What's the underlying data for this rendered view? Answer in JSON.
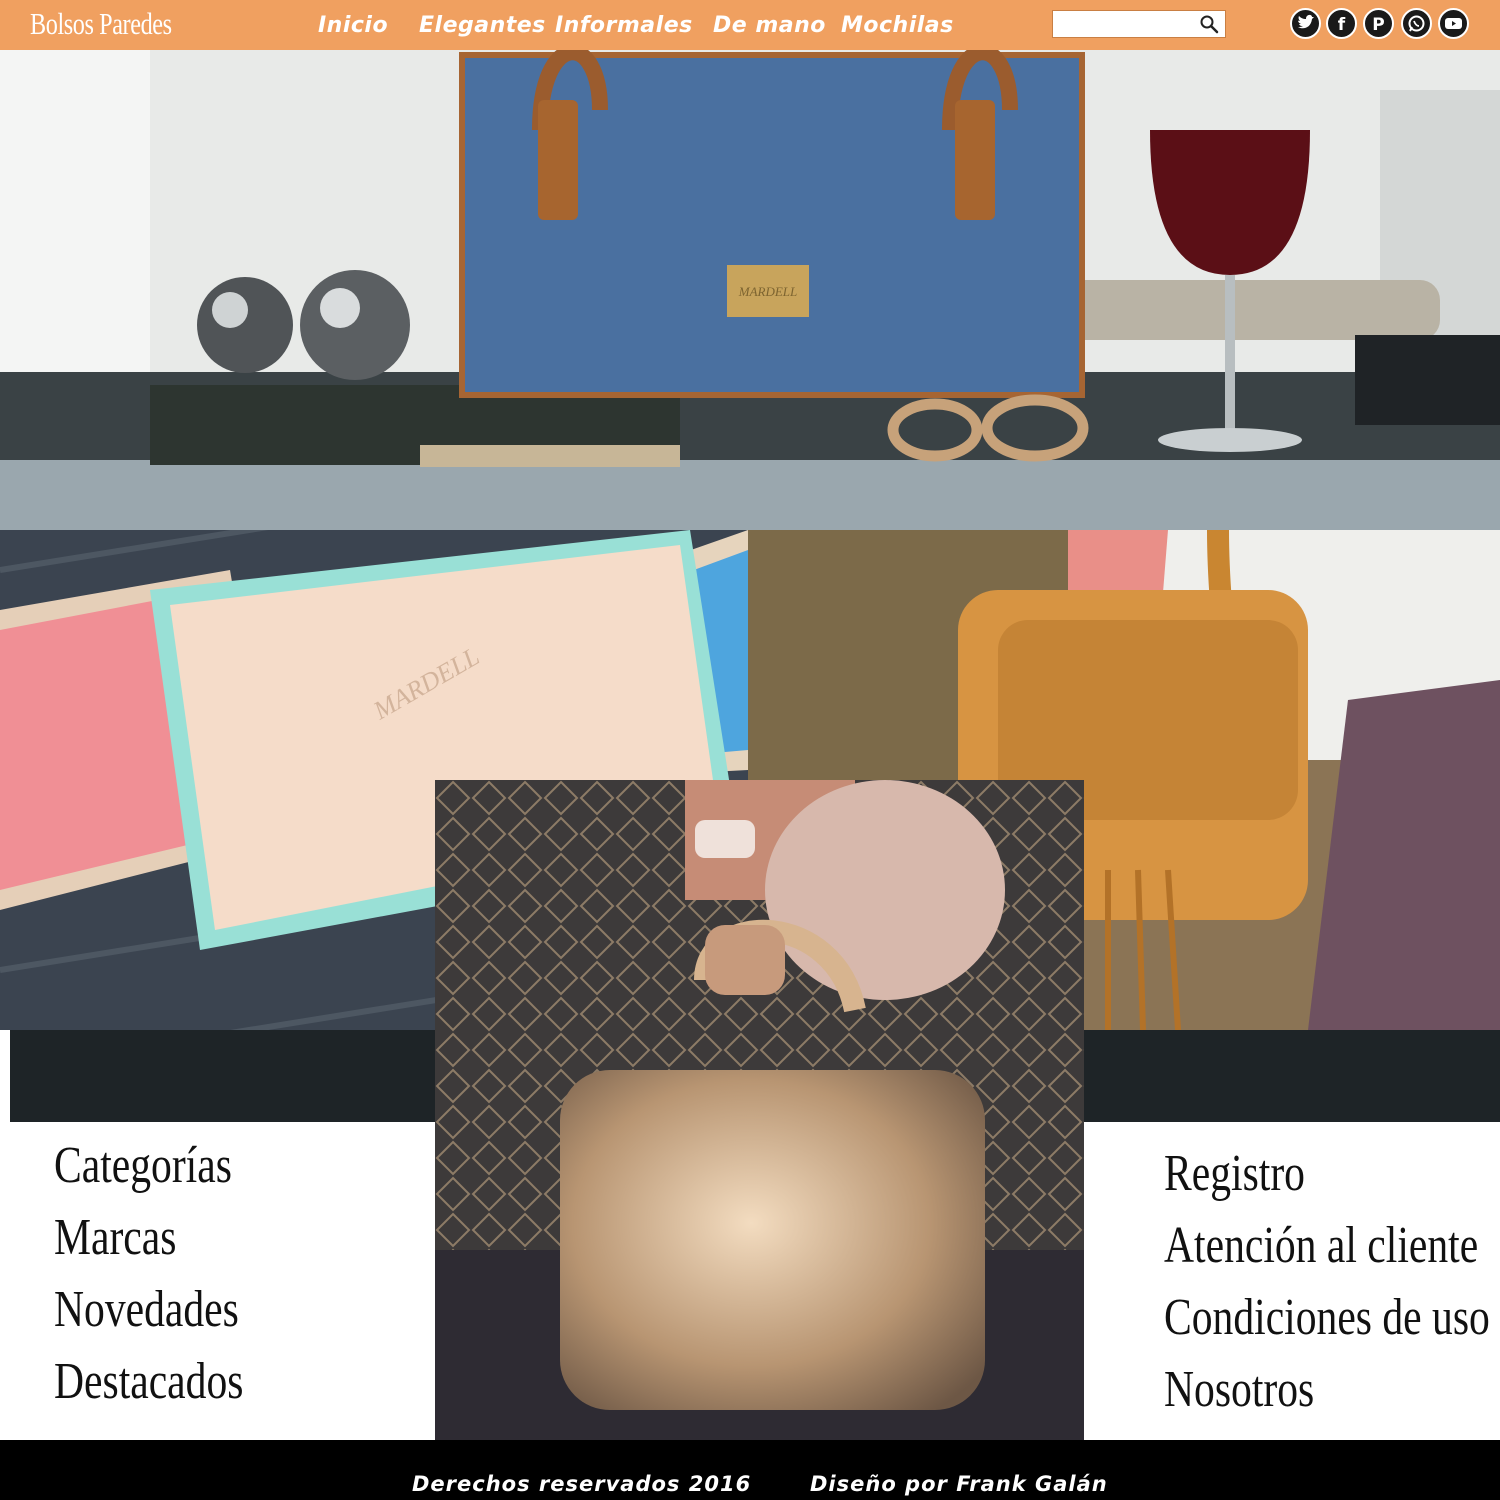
{
  "header": {
    "logo": "Bolsos Paredes",
    "nav": [
      "Inicio",
      "Elegantes",
      "Informales",
      "De mano",
      "Mochilas"
    ],
    "search": {
      "placeholder": "",
      "value": ""
    },
    "social": [
      "twitter-icon",
      "facebook-icon",
      "pinterest-icon",
      "whatsapp-icon",
      "youtube-icon"
    ]
  },
  "gallery": {
    "hero_brand_plate": "MARDELL",
    "wallet_brand": "MARDELL"
  },
  "left_links": [
    "Categorías",
    "Marcas",
    "Novedades",
    "Destacados"
  ],
  "right_links": [
    "Registro",
    "Atención al cliente",
    "Condiciones de uso",
    "Nosotros"
  ],
  "footer": {
    "rights": "Derechos reservados 2016",
    "credit": "Diseño por Frank Galán"
  },
  "colors": {
    "accent": "#f0a060",
    "footer": "#000000",
    "strip": "#1e2427"
  }
}
